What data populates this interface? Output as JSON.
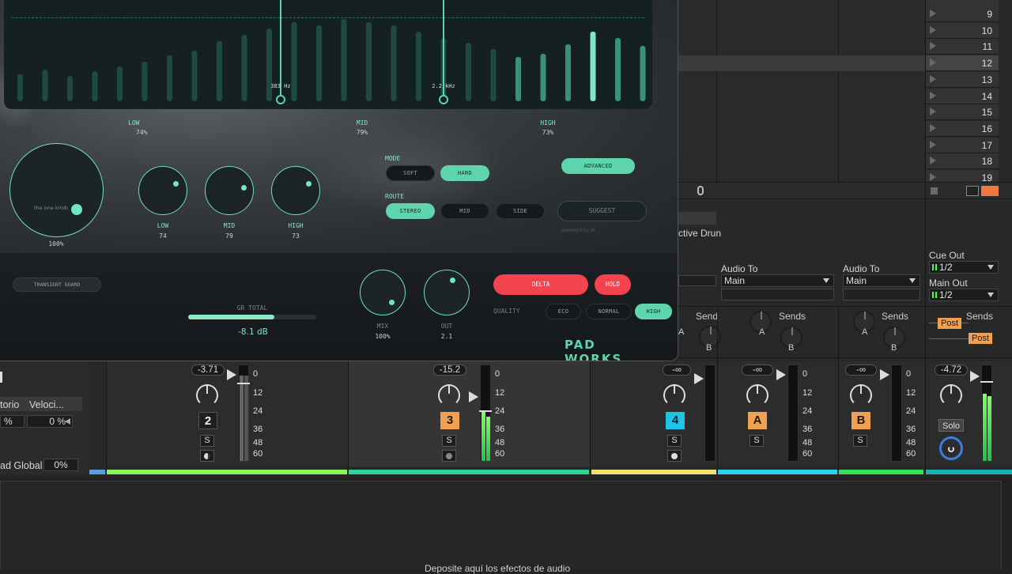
{
  "session": {
    "scene_numbers": [
      "9",
      "10",
      "11",
      "12",
      "13",
      "14",
      "15",
      "16",
      "17",
      "18",
      "19"
    ],
    "partial_track_name": "ctive Drun"
  },
  "io": {
    "audio_to_label": "Audio To",
    "main_value": "Main",
    "cue_out_label": "Cue Out",
    "cue_out_value": "1/2",
    "main_out_label": "Main Out",
    "main_out_value": "1/2"
  },
  "sends": {
    "label": "Sends",
    "label_partial": "Send",
    "a": "A",
    "b": "B",
    "post": "Post"
  },
  "left_panel": {
    "row1": "torio",
    "row1b": "Veloci...",
    "pct1": "%",
    "pct2": "0 %",
    "global_label": "ad Global",
    "global_value": "0%"
  },
  "mixer": {
    "scale": [
      "0",
      "12",
      "24",
      "36",
      "48",
      "60"
    ],
    "strips": [
      {
        "volume": "-3.71",
        "number": "2",
        "solo": "S"
      },
      {
        "volume": "-15.2",
        "number": "3",
        "solo": "S"
      },
      {
        "volume": "-∞",
        "number": "4",
        "solo": "S"
      },
      {
        "volume": "-∞",
        "number": "A",
        "solo": "S"
      },
      {
        "volume": "-∞",
        "number": "B",
        "solo": "S"
      },
      {
        "volume": "-4.72",
        "number": "",
        "solo": "Solo"
      }
    ]
  },
  "drop_zone": "Deposite aquí los efectos de audio",
  "colors": {
    "track2": "#8cf45a",
    "track3": "#2fd39a",
    "track4": "#f0e070",
    "trackA": "#2ed0f0",
    "trackB": "#34e05a",
    "master": "#18b0b0",
    "accent_orange": "#f0a050",
    "plugin_mint": "#5ed5ac",
    "plugin_red": "#f2434f"
  },
  "plugin": {
    "brand": "PAD WORKS",
    "knob_main_label": "the one knob",
    "knob_main_value": "100%",
    "crossover1": "383 Hz",
    "crossover2": "2.2 kHz",
    "bands": [
      {
        "name": "LOW",
        "value": "74%"
      },
      {
        "name": "MID",
        "value": "79%"
      },
      {
        "name": "HIGH",
        "value": "73%"
      }
    ],
    "band_knobs": [
      {
        "name": "LOW",
        "value": "74"
      },
      {
        "name": "MID",
        "value": "79"
      },
      {
        "name": "HIGH",
        "value": "73"
      }
    ],
    "mode_label": "MODE",
    "mode_soft": "SOFT",
    "mode_hard": "HARD",
    "route_label": "ROUTE",
    "route_stereo": "STEREO",
    "route_mid": "MID",
    "route_side": "SIDE",
    "advanced": "ADVANCED",
    "suggest": "SUGGEST",
    "suggest_sub": "powered by AI",
    "transient_guard": "TRANSIENT GUARD",
    "gr_label": "GR TOTAL",
    "gr_value": "-8.1 dB",
    "gr_level": 0.67,
    "mix_label": "MIX",
    "mix_value": "100%",
    "out_label": "OUT",
    "out_value": "2.1",
    "delta": "DELTA",
    "hold": "HOLD",
    "quality_label": "QUALITY",
    "quality_eco": "ECO",
    "quality_normal": "NORMAL",
    "quality_high": "HIGH"
  }
}
